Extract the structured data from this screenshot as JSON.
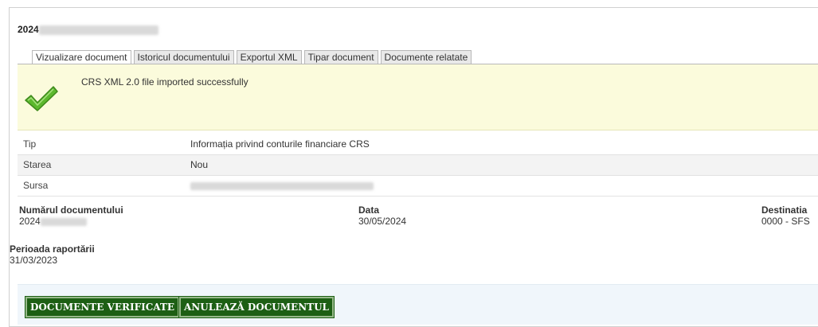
{
  "document": {
    "title_prefix": "2024",
    "tabs": [
      {
        "label": "Vizualizare document",
        "active": true
      },
      {
        "label": "Istoricul documentului",
        "active": false
      },
      {
        "label": "Exportul XML",
        "active": false
      },
      {
        "label": "Tipar document",
        "active": false
      },
      {
        "label": "Documente relatate",
        "active": false
      }
    ],
    "success_message": "CRS XML 2.0 file imported successfully",
    "info": [
      {
        "label": "Tip",
        "value": "Informația privind conturile financiare CRS"
      },
      {
        "label": "Starea",
        "value": "Nou"
      },
      {
        "label": "Sursa",
        "value": ""
      }
    ],
    "numar": {
      "label": "Numărul documentului",
      "value_prefix": "2024"
    },
    "data": {
      "label": "Data",
      "value": "30/05/2024"
    },
    "destinatia": {
      "label": "Destinatia",
      "value": "0000 - SFS"
    },
    "perioada": {
      "label": "Perioada raportării",
      "value": "31/03/2023"
    },
    "buttons": {
      "verified": "DOCUMENTE VERIFICATE",
      "cancel": "ANULEAZĂ DOCUMENTUL"
    },
    "colors": {
      "success_bg": "#fbfbdc",
      "button_bg": "#1d5f14",
      "check": "#5cb82e"
    }
  }
}
